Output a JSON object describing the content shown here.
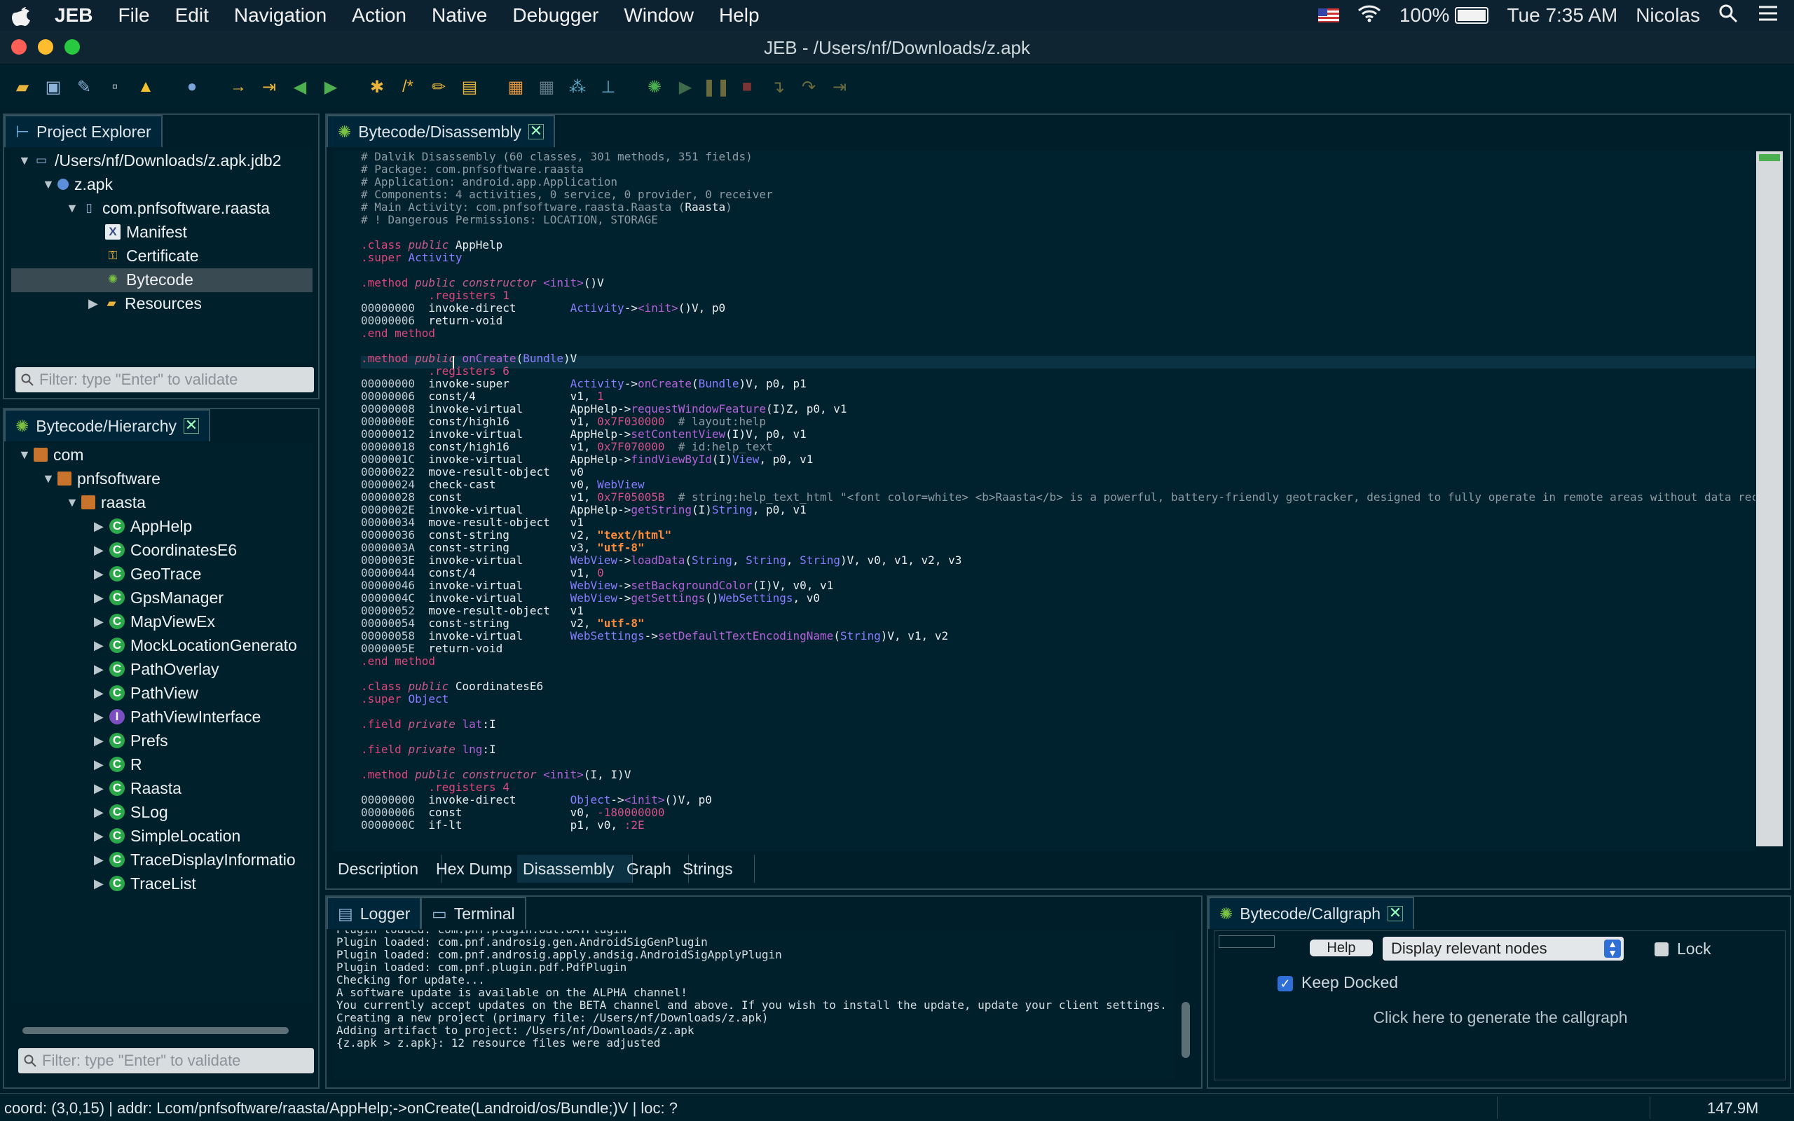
{
  "menubar": {
    "app": "JEB",
    "menus": [
      "File",
      "Edit",
      "Navigation",
      "Action",
      "Native",
      "Debugger",
      "Window",
      "Help"
    ],
    "battery": "100%",
    "clock": "Tue 7:35 AM",
    "user": "Nicolas"
  },
  "window": {
    "title": "JEB - /Users/nf/Downloads/z.apk"
  },
  "project_explorer": {
    "tab": "Project Explorer",
    "items": [
      "/Users/nf/Downloads/z.apk.jdb2",
      "z.apk",
      "com.pnfsoftware.raasta",
      "Manifest",
      "Certificate",
      "Bytecode",
      "Resources"
    ],
    "filter_placeholder": "Filter: type \"Enter\" to validate"
  },
  "hierarchy": {
    "tab": "Bytecode/Hierarchy",
    "items": [
      "com",
      "pnfsoftware",
      "raasta",
      "AppHelp",
      "CoordinatesE6",
      "GeoTrace",
      "GpsManager",
      "MapViewEx",
      "MockLocationGenerato",
      "PathOverlay",
      "PathView",
      "PathViewInterface",
      "Prefs",
      "R",
      "Raasta",
      "SLog",
      "SimpleLocation",
      "TraceDisplayInformatio",
      "TraceList"
    ],
    "filter_placeholder": "Filter: type \"Enter\" to validate"
  },
  "editor": {
    "tab": "Bytecode/Disassembly",
    "bottom_tabs": [
      "Description",
      "Hex Dump",
      "Disassembly",
      "Graph",
      "Strings"
    ],
    "lines": [
      [
        [
          "cm",
          "# Dalvik Disassembly (60 classes, 301 methods, 351 fields)"
        ]
      ],
      [
        [
          "cm",
          "# Package: com.pnfsoftware.raasta"
        ]
      ],
      [
        [
          "cm",
          "# Application: android.app.Application"
        ]
      ],
      [
        [
          "cm",
          "# Components: 4 activities, 0 service, 0 provider, 0 receiver"
        ]
      ],
      [
        [
          "cm",
          "# Main Activity: com.pnfsoftware.raasta.Raasta ("
        ],
        [
          "pl",
          "Raasta"
        ],
        [
          "cm",
          ")"
        ]
      ],
      [
        [
          "cm",
          "# ! Dangerous Permissions: LOCATION, STORAGE"
        ]
      ],
      [],
      [
        [
          "kw",
          ".class "
        ],
        [
          "it",
          "public "
        ],
        [
          "pl",
          "AppHelp"
        ]
      ],
      [
        [
          "kw",
          ".super "
        ],
        [
          "ty",
          "Activity"
        ]
      ],
      [],
      [
        [
          "kw",
          ".method "
        ],
        [
          "it",
          "public constructor "
        ],
        [
          "mt",
          "<init>"
        ],
        [
          "pl",
          "()V"
        ]
      ],
      [
        [
          "pl",
          "          "
        ],
        [
          "kw",
          ".registers "
        ],
        [
          "nu",
          "1"
        ]
      ],
      [
        [
          "of",
          "00000000  "
        ],
        [
          "pl",
          "invoke-direct        "
        ],
        [
          "ty",
          "Activity"
        ],
        [
          "pl",
          "->"
        ],
        [
          "mt",
          "<init>"
        ],
        [
          "pl",
          "()V, p0"
        ]
      ],
      [
        [
          "of",
          "00000006  "
        ],
        [
          "pl",
          "return-void"
        ]
      ],
      [
        [
          "kw",
          ".end method"
        ]
      ],
      [],
      [
        [
          "kw",
          ".method "
        ],
        [
          "it",
          "public "
        ],
        [
          "mt",
          "onCreate"
        ],
        [
          "pl",
          "("
        ],
        [
          "ty",
          "Bundle"
        ],
        [
          "pl",
          ")V"
        ]
      ],
      [
        [
          "pl",
          "          "
        ],
        [
          "kw",
          ".registers "
        ],
        [
          "nu",
          "6"
        ]
      ],
      [
        [
          "of",
          "00000000  "
        ],
        [
          "pl",
          "invoke-super         "
        ],
        [
          "ty",
          "Activity"
        ],
        [
          "pl",
          "->"
        ],
        [
          "mt",
          "onCreate"
        ],
        [
          "pl",
          "("
        ],
        [
          "ty",
          "Bundle"
        ],
        [
          "pl",
          ")V, p0, p1"
        ]
      ],
      [
        [
          "of",
          "00000006  "
        ],
        [
          "pl",
          "const/4              v1, "
        ],
        [
          "nu",
          "1"
        ]
      ],
      [
        [
          "of",
          "00000008  "
        ],
        [
          "pl",
          "invoke-virtual       AppHelp->"
        ],
        [
          "mt",
          "requestWindowFeature"
        ],
        [
          "pl",
          "(I)Z, p0, v1"
        ]
      ],
      [
        [
          "of",
          "0000000E  "
        ],
        [
          "pl",
          "const/high16         v1, "
        ],
        [
          "nu",
          "0x7F030000"
        ],
        [
          "cm",
          "  # layout:help"
        ]
      ],
      [
        [
          "of",
          "00000012  "
        ],
        [
          "pl",
          "invoke-virtual       AppHelp->"
        ],
        [
          "mt",
          "setContentView"
        ],
        [
          "pl",
          "(I)V, p0, v1"
        ]
      ],
      [
        [
          "of",
          "00000018  "
        ],
        [
          "pl",
          "const/high16         v1, "
        ],
        [
          "nu",
          "0x7F070000"
        ],
        [
          "cm",
          "  # id:help_text"
        ]
      ],
      [
        [
          "of",
          "0000001C  "
        ],
        [
          "pl",
          "invoke-virtual       AppHelp->"
        ],
        [
          "mt",
          "findViewById"
        ],
        [
          "pl",
          "(I)"
        ],
        [
          "ty",
          "View"
        ],
        [
          "pl",
          ", p0, v1"
        ]
      ],
      [
        [
          "of",
          "00000022  "
        ],
        [
          "pl",
          "move-result-object   v0"
        ]
      ],
      [
        [
          "of",
          "00000024  "
        ],
        [
          "pl",
          "check-cast           v0, "
        ],
        [
          "ty",
          "WebView"
        ]
      ],
      [
        [
          "of",
          "00000028  "
        ],
        [
          "pl",
          "const                v1, "
        ],
        [
          "nu",
          "0x7F05005B"
        ],
        [
          "cm",
          "  # string:help_text_html \"<font color=white> <b>Raasta</b> is a powerful, battery-friendly geotracker, designed to fully operate in remote areas without data rec"
        ]
      ],
      [
        [
          "of",
          "0000002E  "
        ],
        [
          "pl",
          "invoke-virtual       AppHelp->"
        ],
        [
          "mt",
          "getString"
        ],
        [
          "pl",
          "(I)"
        ],
        [
          "ty",
          "String"
        ],
        [
          "pl",
          ", p0, v1"
        ]
      ],
      [
        [
          "of",
          "00000034  "
        ],
        [
          "pl",
          "move-result-object   v1"
        ]
      ],
      [
        [
          "of",
          "00000036  "
        ],
        [
          "pl",
          "const-string         v2, "
        ],
        [
          "st",
          "\"text/html\""
        ]
      ],
      [
        [
          "of",
          "0000003A  "
        ],
        [
          "pl",
          "const-string         v3, "
        ],
        [
          "st",
          "\"utf-8\""
        ]
      ],
      [
        [
          "of",
          "0000003E  "
        ],
        [
          "pl",
          "invoke-virtual       "
        ],
        [
          "ty",
          "WebView"
        ],
        [
          "pl",
          "->"
        ],
        [
          "mt",
          "loadData"
        ],
        [
          "pl",
          "("
        ],
        [
          "ty",
          "String"
        ],
        [
          "pl",
          ", "
        ],
        [
          "ty",
          "String"
        ],
        [
          "pl",
          ", "
        ],
        [
          "ty",
          "String"
        ],
        [
          "pl",
          ")V, v0, v1, v2, v3"
        ]
      ],
      [
        [
          "of",
          "00000044  "
        ],
        [
          "pl",
          "const/4              v1, "
        ],
        [
          "nu",
          "0"
        ]
      ],
      [
        [
          "of",
          "00000046  "
        ],
        [
          "pl",
          "invoke-virtual       "
        ],
        [
          "ty",
          "WebView"
        ],
        [
          "pl",
          "->"
        ],
        [
          "mt",
          "setBackgroundColor"
        ],
        [
          "pl",
          "(I)V, v0, v1"
        ]
      ],
      [
        [
          "of",
          "0000004C  "
        ],
        [
          "pl",
          "invoke-virtual       "
        ],
        [
          "ty",
          "WebView"
        ],
        [
          "pl",
          "->"
        ],
        [
          "mt",
          "getSettings"
        ],
        [
          "pl",
          "()"
        ],
        [
          "ty",
          "WebSettings"
        ],
        [
          "pl",
          ", v0"
        ]
      ],
      [
        [
          "of",
          "00000052  "
        ],
        [
          "pl",
          "move-result-object   v1"
        ]
      ],
      [
        [
          "of",
          "00000054  "
        ],
        [
          "pl",
          "const-string         v2, "
        ],
        [
          "st",
          "\"utf-8\""
        ]
      ],
      [
        [
          "of",
          "00000058  "
        ],
        [
          "pl",
          "invoke-virtual       "
        ],
        [
          "ty",
          "WebSettings"
        ],
        [
          "pl",
          "->"
        ],
        [
          "mt",
          "setDefaultTextEncodingName"
        ],
        [
          "pl",
          "("
        ],
        [
          "ty",
          "String"
        ],
        [
          "pl",
          ")V, v1, v2"
        ]
      ],
      [
        [
          "of",
          "0000005E  "
        ],
        [
          "pl",
          "return-void"
        ]
      ],
      [
        [
          "kw",
          ".end method"
        ]
      ],
      [],
      [
        [
          "kw",
          ".class "
        ],
        [
          "it",
          "public "
        ],
        [
          "pl",
          "CoordinatesE6"
        ]
      ],
      [
        [
          "kw",
          ".super "
        ],
        [
          "ty",
          "Object"
        ]
      ],
      [],
      [
        [
          "kw",
          ".field "
        ],
        [
          "it",
          "private "
        ],
        [
          "mt",
          "lat"
        ],
        [
          "pl",
          ":I"
        ]
      ],
      [],
      [
        [
          "kw",
          ".field "
        ],
        [
          "it",
          "private "
        ],
        [
          "mt",
          "lng"
        ],
        [
          "pl",
          ":I"
        ]
      ],
      [],
      [
        [
          "kw",
          ".method "
        ],
        [
          "it",
          "public constructor "
        ],
        [
          "mt",
          "<init>"
        ],
        [
          "pl",
          "(I, I)V"
        ]
      ],
      [
        [
          "pl",
          "          "
        ],
        [
          "kw",
          ".registers "
        ],
        [
          "nu",
          "4"
        ]
      ],
      [
        [
          "of",
          "00000000  "
        ],
        [
          "pl",
          "invoke-direct        "
        ],
        [
          "ty",
          "Object"
        ],
        [
          "pl",
          "->"
        ],
        [
          "mt",
          "<init>"
        ],
        [
          "pl",
          "()V, p0"
        ]
      ],
      [
        [
          "of",
          "00000006  "
        ],
        [
          "pl",
          "const                v0, "
        ],
        [
          "nu",
          "-180000000"
        ]
      ],
      [
        [
          "of",
          "0000000C  "
        ],
        [
          "pl",
          "if-lt                p1, v0, "
        ],
        [
          "nu",
          ":2E"
        ]
      ]
    ]
  },
  "logger": {
    "tabs": [
      "Logger",
      "Terminal"
    ],
    "text": "Plugin loaded: com.pnf.plugin.oat.OATPlugin\nPlugin loaded: com.pnf.androsig.gen.AndroidSigGenPlugin\nPlugin loaded: com.pnf.androsig.apply.andsig.AndroidSigApplyPlugin\nPlugin loaded: com.pnf.plugin.pdf.PdfPlugin\nChecking for update...\nA software update is available on the ALPHA channel!\nYou currently accept updates on the BETA channel and above. If you wish to install the update, update your client settings.\nCreating a new project (primary file: /Users/nf/Downloads/z.apk)\nAdding artifact to project: /Users/nf/Downloads/z.apk\n{z.apk > z.apk}: 12 resource files were adjusted"
  },
  "callgraph": {
    "tab": "Bytecode/Callgraph",
    "help": "Help",
    "mode": "Display relevant nodes",
    "lock": "Lock",
    "keep_docked": "Keep Docked",
    "hint": "Click here to generate the callgraph"
  },
  "status": {
    "text": "coord: (3,0,15) | addr: Lcom/pnfsoftware/raasta/AppHelp;->onCreate(Landroid/os/Bundle;)V | loc: ?",
    "memory": "147.9M"
  }
}
